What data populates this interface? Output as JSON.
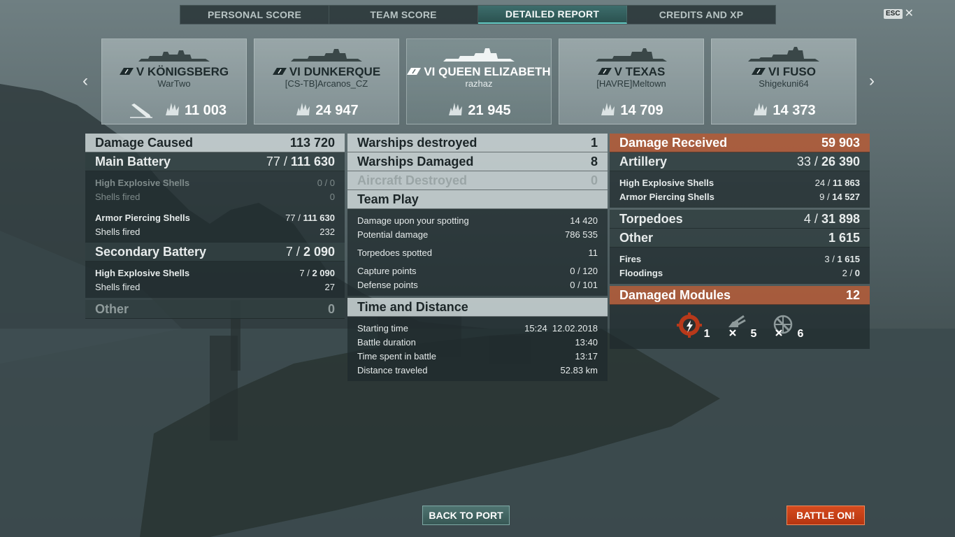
{
  "tabs": [
    "PERSONAL SCORE",
    "TEAM SCORE",
    "DETAILED REPORT",
    "CREDITS AND XP"
  ],
  "active_tab": "DETAILED REPORT",
  "esc": {
    "key": "ESC",
    "close": "✕"
  },
  "nav": {
    "prev": "‹",
    "next": "›"
  },
  "cards": [
    {
      "ship": "V KÖNIGSBERG",
      "player": "WarTwo",
      "damage": "11 003",
      "sunk": true,
      "highlight": false
    },
    {
      "ship": "VI DUNKERQUE",
      "player": "[CS-TB]Arcanos_CZ",
      "damage": "24 947",
      "sunk": false,
      "highlight": false
    },
    {
      "ship": "VI QUEEN ELIZABETH",
      "player": "razhaz",
      "damage": "21 945",
      "sunk": false,
      "highlight": true
    },
    {
      "ship": "V TEXAS",
      "player": "[HAVRE]Meltown",
      "damage": "14 709",
      "sunk": false,
      "highlight": false
    },
    {
      "ship": "VI FUSO",
      "player": "Shigekuni64",
      "damage": "14 373",
      "sunk": false,
      "highlight": false
    }
  ],
  "left": {
    "damage_caused": {
      "label": "Damage Caused",
      "value": "113 720"
    },
    "main_battery": {
      "label": "Main Battery",
      "hits": "77 /",
      "value": "111 630"
    },
    "mb_he": {
      "label": "High Explosive Shells",
      "value": "0 / 0"
    },
    "mb_he_fired": {
      "label": "Shells fired",
      "value": "0"
    },
    "mb_ap": {
      "label": "Armor Piercing Shells",
      "hits": "77 /",
      "value": "111 630"
    },
    "mb_ap_fired": {
      "label": "Shells fired",
      "value": "232"
    },
    "secondary": {
      "label": "Secondary Battery",
      "hits": "7 /",
      "value": "2 090"
    },
    "sec_he": {
      "label": "High Explosive Shells",
      "hits": "7 /",
      "value": "2 090"
    },
    "sec_fired": {
      "label": "Shells fired",
      "value": "27"
    },
    "other": {
      "label": "Other",
      "value": "0"
    }
  },
  "middle": {
    "destroyed": {
      "label": "Warships destroyed",
      "value": "1"
    },
    "damaged": {
      "label": "Warships Damaged",
      "value": "8"
    },
    "aircraft": {
      "label": "Aircraft Destroyed",
      "value": "0"
    },
    "team_play": {
      "label": "Team Play"
    },
    "spotting": {
      "label": "Damage upon your spotting",
      "value": "14 420"
    },
    "potential": {
      "label": "Potential damage",
      "value": "786 535"
    },
    "torp_spotted": {
      "label": "Torpedoes spotted",
      "value": "11"
    },
    "capture": {
      "label": "Capture points",
      "value": "0 / 120"
    },
    "defense": {
      "label": "Defense points",
      "value": "0 / 101"
    },
    "time_distance": {
      "label": "Time and Distance"
    },
    "start": {
      "label": "Starting time",
      "value": "15:24  12.02.2018"
    },
    "duration": {
      "label": "Battle duration",
      "value": "13:40"
    },
    "time_spent": {
      "label": "Time spent in battle",
      "value": "13:17"
    },
    "distance": {
      "label": "Distance traveled",
      "value": "52.83 km"
    }
  },
  "right": {
    "received": {
      "label": "Damage Received",
      "value": "59 903"
    },
    "artillery": {
      "label": "Artillery",
      "hits": "33 /",
      "value": "26 390"
    },
    "art_he": {
      "label": "High Explosive Shells",
      "hits": "24 /",
      "value": "11 863"
    },
    "art_ap": {
      "label": "Armor Piercing Shells",
      "hits": "9 /",
      "value": "14 527"
    },
    "torpedoes": {
      "label": "Torpedoes",
      "hits": "4 /",
      "value": "31 898"
    },
    "other": {
      "label": "Other",
      "value": "1 615"
    },
    "fires": {
      "label": "Fires",
      "hits": "3 /",
      "value": "1 615"
    },
    "floodings": {
      "label": "Floodings",
      "hits": "2 /",
      "value": "0"
    },
    "modules": {
      "label": "Damaged Modules",
      "value": "12"
    },
    "module_counts": [
      {
        "icon": "engine-module-icon",
        "count": "1"
      },
      {
        "icon": "main-gun-module-icon",
        "count": "5"
      },
      {
        "icon": "secondary-gun-module-icon",
        "count": "6"
      }
    ]
  },
  "buttons": {
    "back": "BACK TO PORT",
    "battle": "BATTLE ON!"
  },
  "colors": {
    "accent": "#63c9c2",
    "battle": "#c63e15",
    "received": "#b05c3a"
  }
}
